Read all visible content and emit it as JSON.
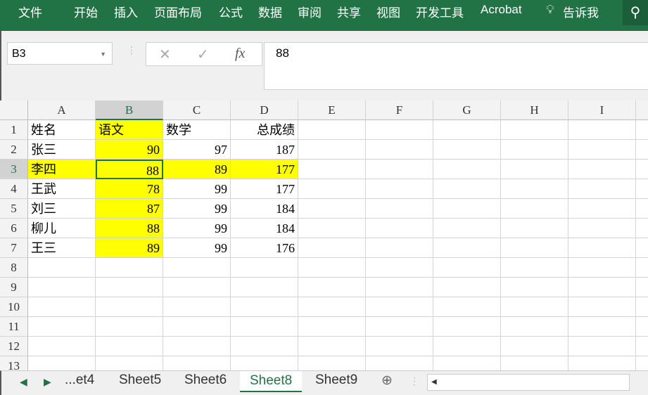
{
  "ribbon": {
    "tabs": [
      "文件",
      "开始",
      "插入",
      "页面布局",
      "公式",
      "数据",
      "审阅",
      "共享",
      "视图",
      "开发工具",
      "Acrobat"
    ],
    "tell_me": "告诉我"
  },
  "formula_bar": {
    "name_box": "B3",
    "value": "88",
    "fx": "fx",
    "cancel": "✕",
    "enter": "✓"
  },
  "columns": [
    "A",
    "B",
    "C",
    "D",
    "E",
    "F",
    "G",
    "H",
    "I"
  ],
  "rows": [
    "1",
    "2",
    "3",
    "4",
    "5",
    "6",
    "7",
    "8",
    "9",
    "10",
    "11",
    "12",
    "13"
  ],
  "table": [
    [
      "姓名",
      "语文",
      "数学",
      "总成绩"
    ],
    [
      "张三",
      "90",
      "97",
      "187"
    ],
    [
      "李四",
      "88",
      "89",
      "177"
    ],
    [
      "王武",
      "78",
      "99",
      "177"
    ],
    [
      "刘三",
      "87",
      "99",
      "184"
    ],
    [
      "柳儿",
      "88",
      "99",
      "184"
    ],
    [
      "王三",
      "89",
      "99",
      "176"
    ]
  ],
  "highlight_color": "#ffff00",
  "accent_color": "#217346",
  "sheets": {
    "truncated_first": "...et4",
    "tabs": [
      "Sheet5",
      "Sheet6",
      "Sheet8",
      "Sheet9"
    ],
    "active": "Sheet8"
  }
}
